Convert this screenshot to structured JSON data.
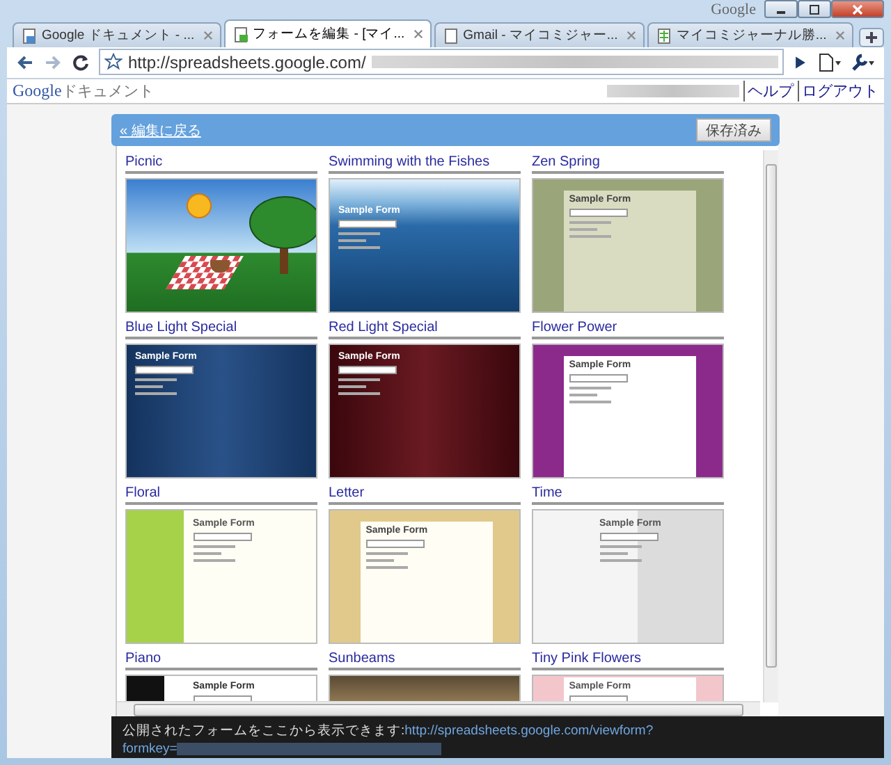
{
  "window": {
    "title": "Google"
  },
  "tabs": [
    {
      "label": "Google ドキュメント - ...",
      "selected": false,
      "kind": "doc"
    },
    {
      "label": "フォームを編集 - [マイ...",
      "selected": true,
      "kind": "form"
    },
    {
      "label": "Gmail - マイコミジャー...",
      "selected": false,
      "kind": "page"
    },
    {
      "label": "マイコミジャーナル勝...",
      "selected": false,
      "kind": "sheet"
    }
  ],
  "toolbar": {
    "address": "http://spreadsheets.google.com/"
  },
  "header": {
    "logo": "Google",
    "product": "ドキュメント",
    "links": [
      "ヘルプ",
      "ログアウト"
    ]
  },
  "action_bar": {
    "back_link": "« 編集に戻る",
    "status_button": "保存済み"
  },
  "themes": [
    {
      "name": "Picnic",
      "kind": "picnic"
    },
    {
      "name": "Swimming with the Fishes",
      "kind": "sea",
      "preview_title": "Sample Form"
    },
    {
      "name": "Zen Spring",
      "kind": "zen",
      "preview_title": "Sample Form"
    },
    {
      "name": "Blue Light Special",
      "kind": "blue",
      "preview_title": "Sample Form"
    },
    {
      "name": "Red Light Special",
      "kind": "red",
      "preview_title": "Sample Form"
    },
    {
      "name": "Flower Power",
      "kind": "flower",
      "preview_title": "Sample Form"
    },
    {
      "name": "Floral",
      "kind": "floral",
      "preview_title": "Sample Form"
    },
    {
      "name": "Letter",
      "kind": "letter",
      "preview_title": "Sample Form"
    },
    {
      "name": "Time",
      "kind": "time",
      "preview_title": "Sample Form"
    },
    {
      "name": "Piano",
      "kind": "piano",
      "preview_title": "Sample Form"
    },
    {
      "name": "Sunbeams",
      "kind": "sunbeams"
    },
    {
      "name": "Tiny Pink Flowers",
      "kind": "pink",
      "preview_title": "Sample Form"
    }
  ],
  "notice": {
    "text": "公開されたフォームをここから表示できます: ",
    "link": "http://spreadsheets.google.com/viewform?",
    "link_2": "formkey="
  }
}
